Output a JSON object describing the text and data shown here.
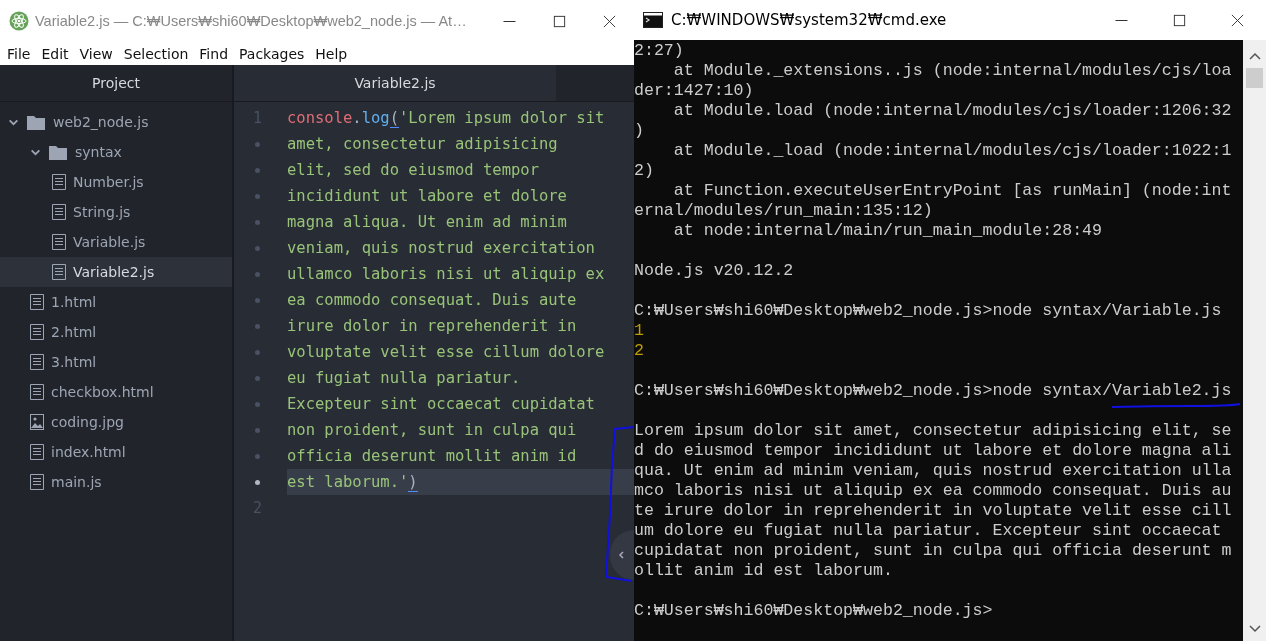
{
  "editor_window": {
    "title": "Variable2.js — C:₩Users₩shi60₩Desktop₩web2_node.js — At…",
    "menu": [
      "File",
      "Edit",
      "View",
      "Selection",
      "Find",
      "Packages",
      "Help"
    ],
    "tree_view": {
      "title": "Project",
      "items": [
        {
          "kind": "folder",
          "label": "web2_node.js",
          "expanded": true,
          "selected": false,
          "children": [
            {
              "kind": "folder",
              "label": "syntax",
              "expanded": true,
              "selected": false,
              "children": [
                {
                  "kind": "file",
                  "label": "Number.js",
                  "selected": false
                },
                {
                  "kind": "file",
                  "label": "String.js",
                  "selected": false
                },
                {
                  "kind": "file",
                  "label": "Variable.js",
                  "selected": false
                },
                {
                  "kind": "file",
                  "label": "Variable2.js",
                  "selected": true
                }
              ]
            },
            {
              "kind": "file",
              "label": "1.html",
              "selected": false
            },
            {
              "kind": "file",
              "label": "2.html",
              "selected": false
            },
            {
              "kind": "file",
              "label": "3.html",
              "selected": false
            },
            {
              "kind": "file",
              "label": "checkbox.html",
              "selected": false
            },
            {
              "kind": "image",
              "label": "coding.jpg",
              "selected": false
            },
            {
              "kind": "file",
              "label": "index.html",
              "selected": false
            },
            {
              "kind": "file",
              "label": "main.js",
              "selected": false
            }
          ]
        }
      ]
    },
    "tabs": [
      {
        "label": "Variable2.js",
        "selected": true
      }
    ],
    "code_rows": [
      {
        "number": "1",
        "current": false,
        "segments": [
          {
            "kind": "object",
            "text": "console"
          },
          {
            "kind": "punct",
            "text": "."
          },
          {
            "kind": "function",
            "text": "log"
          },
          {
            "kind": "match",
            "text": "("
          },
          {
            "kind": "string",
            "text": "'Lorem ipsum dolor sit"
          }
        ]
      },
      {
        "current": false,
        "segments": [
          {
            "kind": "string",
            "text": "amet, consectetur adipisicing"
          }
        ]
      },
      {
        "current": false,
        "segments": [
          {
            "kind": "string",
            "text": "elit, sed do eiusmod tempor"
          }
        ]
      },
      {
        "current": false,
        "segments": [
          {
            "kind": "string",
            "text": "incididunt ut labore et dolore"
          }
        ]
      },
      {
        "current": false,
        "segments": [
          {
            "kind": "string",
            "text": "magna aliqua. Ut enim ad minim"
          }
        ]
      },
      {
        "current": false,
        "segments": [
          {
            "kind": "string",
            "text": "veniam, quis nostrud exercitation"
          }
        ]
      },
      {
        "current": false,
        "segments": [
          {
            "kind": "string",
            "text": "ullamco laboris nisi ut aliquip ex"
          }
        ]
      },
      {
        "current": false,
        "segments": [
          {
            "kind": "string",
            "text": "ea commodo consequat. Duis aute"
          }
        ]
      },
      {
        "current": false,
        "segments": [
          {
            "kind": "string",
            "text": "irure dolor in reprehenderit in"
          }
        ]
      },
      {
        "current": false,
        "segments": [
          {
            "kind": "string",
            "text": "voluptate velit esse cillum dolore"
          }
        ]
      },
      {
        "current": false,
        "segments": [
          {
            "kind": "string",
            "text": "eu fugiat nulla pariatur."
          }
        ]
      },
      {
        "current": false,
        "segments": [
          {
            "kind": "string",
            "text": "Excepteur sint occaecat cupidatat"
          }
        ]
      },
      {
        "current": false,
        "segments": [
          {
            "kind": "string",
            "text": "non proident, sunt in culpa qui"
          }
        ]
      },
      {
        "current": false,
        "segments": [
          {
            "kind": "string",
            "text": "officia deserunt mollit anim id"
          }
        ]
      },
      {
        "current": true,
        "segments": [
          {
            "kind": "string",
            "text": "est laborum.'"
          },
          {
            "kind": "match",
            "text": ")"
          }
        ]
      },
      {
        "number": "2",
        "current": false,
        "segments": []
      }
    ]
  },
  "console_window": {
    "title": "C:₩WINDOWS₩system32₩cmd.exe",
    "lines": [
      {
        "kind": "text",
        "text": "2:27)"
      },
      {
        "kind": "text",
        "text": "    at Module._extensions..js (node:internal/modules/cjs/loa"
      },
      {
        "kind": "text",
        "text": "der:1427:10)"
      },
      {
        "kind": "text",
        "text": "    at Module.load (node:internal/modules/cjs/loader:1206:32"
      },
      {
        "kind": "text",
        "text": ")"
      },
      {
        "kind": "text",
        "text": "    at Module._load (node:internal/modules/cjs/loader:1022:1"
      },
      {
        "kind": "text",
        "text": "2)"
      },
      {
        "kind": "text",
        "text": "    at Function.executeUserEntryPoint [as runMain] (node:int"
      },
      {
        "kind": "text",
        "text": "ernal/modules/run_main:135:12)"
      },
      {
        "kind": "text",
        "text": "    at node:internal/main/run_main_module:28:49"
      },
      {
        "kind": "blank"
      },
      {
        "kind": "text",
        "text": "Node.js v20.12.2"
      },
      {
        "kind": "blank"
      },
      {
        "kind": "text",
        "text": "C:₩Users₩shi60₩Desktop₩web2_node.js>node syntax/Variable.js"
      },
      {
        "kind": "output",
        "text": "1"
      },
      {
        "kind": "output",
        "text": "2"
      },
      {
        "kind": "blank"
      },
      {
        "kind": "text",
        "text": "C:₩Users₩shi60₩Desktop₩web2_node.js>node syntax/Variable2.js"
      },
      {
        "kind": "blank"
      },
      {
        "kind": "text",
        "text": "Lorem ipsum dolor sit amet, consectetur adipisicing elit, se"
      },
      {
        "kind": "text",
        "text": "d do eiusmod tempor incididunt ut labore et dolore magna ali"
      },
      {
        "kind": "text",
        "text": "qua. Ut enim ad minim veniam, quis nostrud exercitation ulla"
      },
      {
        "kind": "text",
        "text": "mco laboris nisi ut aliquip ex ea commodo consequat. Duis au"
      },
      {
        "kind": "text",
        "text": "te irure dolor in reprehenderit in voluptate velit esse cill"
      },
      {
        "kind": "text",
        "text": "um dolore eu fugiat nulla pariatur. Excepteur sint occaecat"
      },
      {
        "kind": "text",
        "text": "cupidatat non proident, sunt in culpa qui officia deserunt m"
      },
      {
        "kind": "text",
        "text": "ollit anim id est laborum."
      },
      {
        "kind": "blank"
      },
      {
        "kind": "text",
        "text": "C:₩Users₩shi60₩Desktop₩web2_node.js>"
      }
    ]
  }
}
